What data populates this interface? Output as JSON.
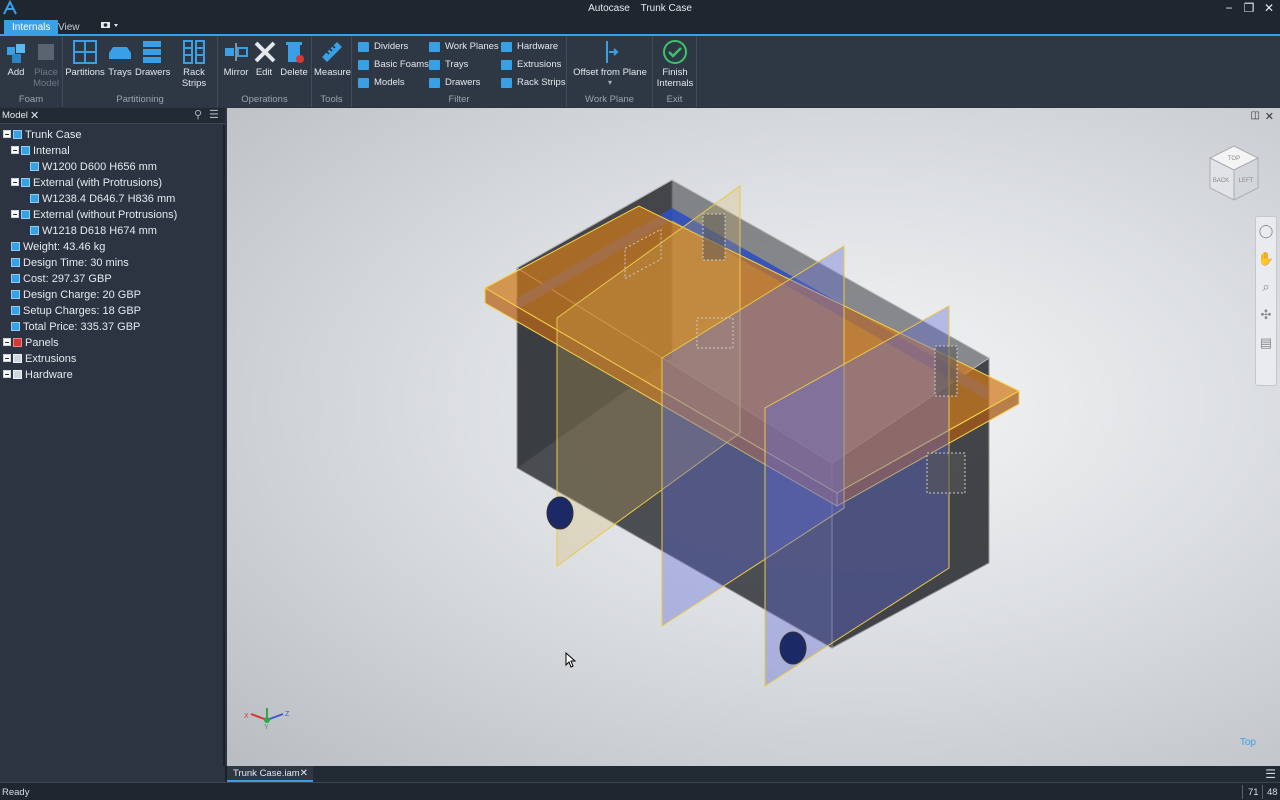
{
  "window": {
    "app_name": "Autocase",
    "doc_title": "Trunk Case",
    "minimize": "−",
    "restore": "❒",
    "close": "✕"
  },
  "tabs": [
    {
      "label": "Internals",
      "active": true
    },
    {
      "label": "View",
      "active": false
    }
  ],
  "ribbon": {
    "foam": {
      "label": "Foam",
      "add": "Add",
      "place_model": "Place Model"
    },
    "partitioning": {
      "label": "Partitioning",
      "partitions": "Partitions",
      "trays": "Trays",
      "drawers": "Drawers",
      "rack_strips": "Rack Strips"
    },
    "operations": {
      "label": "Operations",
      "mirror": "Mirror",
      "edit": "Edit",
      "delete": "Delete"
    },
    "tools": {
      "label": "Tools",
      "measure": "Measure"
    },
    "filter": {
      "label": "Filter",
      "items": [
        "Dividers",
        "Basic Foams",
        "Models",
        "Work Planes",
        "Trays",
        "Drawers",
        "Hardware",
        "Extrusions",
        "Rack Strips"
      ]
    },
    "work_plane": {
      "label": "Work Plane",
      "offset": "Offset from Plane"
    },
    "exit": {
      "label": "Exit",
      "finish": "Finish Internals"
    }
  },
  "model_panel": {
    "tab": "Model",
    "close": "✕",
    "tree": [
      {
        "label": "Trunk Case",
        "level": 0,
        "expand": true,
        "icon": "assembly"
      },
      {
        "label": "Internal",
        "level": 1,
        "expand": true,
        "icon": "param"
      },
      {
        "label": "W1200 D600 H656 mm",
        "level": 2,
        "expand": false,
        "icon": "dim"
      },
      {
        "label": "External (with Protrusions)",
        "level": 1,
        "expand": true,
        "icon": "param"
      },
      {
        "label": "W1238.4 D646.7 H836 mm",
        "level": 2,
        "expand": false,
        "icon": "dim"
      },
      {
        "label": "External (without Protrusions)",
        "level": 1,
        "expand": true,
        "icon": "param"
      },
      {
        "label": "W1218 D618 H674 mm",
        "level": 2,
        "expand": false,
        "icon": "dim"
      },
      {
        "label": "Weight: 43.46 kg",
        "level": 1,
        "expand": false,
        "icon": "param"
      },
      {
        "label": "Design Time: 30 mins",
        "level": 1,
        "expand": false,
        "icon": "param"
      },
      {
        "label": "Cost: 297.37 GBP",
        "level": 1,
        "expand": false,
        "icon": "param"
      },
      {
        "label": "Design Charge: 20 GBP",
        "level": 1,
        "expand": false,
        "icon": "param"
      },
      {
        "label": "Setup Charges: 18 GBP",
        "level": 1,
        "expand": false,
        "icon": "param"
      },
      {
        "label": "Total Price: 335.37 GBP",
        "level": 1,
        "expand": false,
        "icon": "param"
      },
      {
        "label": "Panels",
        "level": 0,
        "expand": true,
        "icon": "panels"
      },
      {
        "label": "Extrusions",
        "level": 0,
        "expand": true,
        "icon": "folder"
      },
      {
        "label": "Hardware",
        "level": 0,
        "expand": true,
        "icon": "folder"
      }
    ]
  },
  "viewport": {
    "viewcube_faces": [
      "TOP",
      "BACK",
      "LEFT"
    ],
    "view_label": "Top",
    "axes": [
      "X",
      "Y",
      "Z"
    ]
  },
  "document_tab": {
    "label": "Trunk Case.iam",
    "close": "✕"
  },
  "status": {
    "text": "Ready",
    "n1": "71",
    "n2": "48"
  }
}
